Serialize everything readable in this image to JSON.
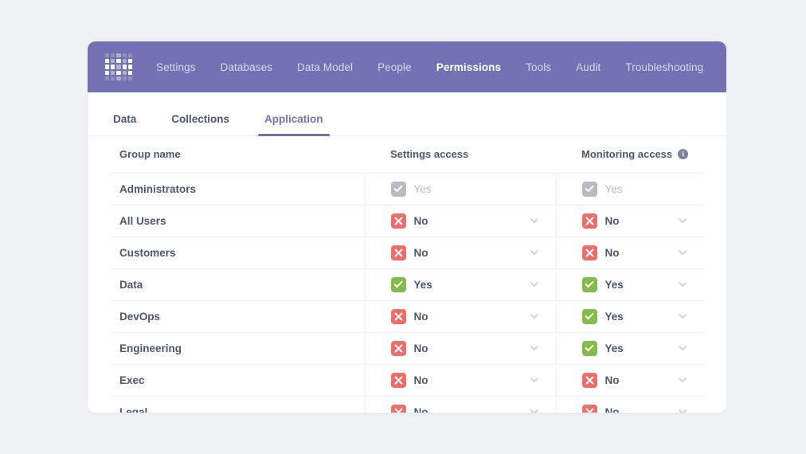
{
  "navbar": {
    "logo_name": "metabase-logo",
    "accent_color": "#7471b3",
    "links": [
      {
        "label": "Settings",
        "active": false
      },
      {
        "label": "Databases",
        "active": false
      },
      {
        "label": "Data Model",
        "active": false
      },
      {
        "label": "People",
        "active": false
      },
      {
        "label": "Permissions",
        "active": true
      },
      {
        "label": "Tools",
        "active": false
      },
      {
        "label": "Audit",
        "active": false
      },
      {
        "label": "Troubleshooting",
        "active": false
      }
    ]
  },
  "subtabs": [
    {
      "label": "Data",
      "active": false
    },
    {
      "label": "Collections",
      "active": false
    },
    {
      "label": "Application",
      "active": true
    }
  ],
  "table": {
    "columns": {
      "group": "Group name",
      "settings": "Settings access",
      "monitoring": "Monitoring access"
    },
    "monitoring_info_icon": "info-icon",
    "monitoring_info_glyph": "i",
    "rows": [
      {
        "group": "Administrators",
        "settings": {
          "value": "Yes",
          "state": "disabled",
          "has_dropdown": false
        },
        "monitoring": {
          "value": "Yes",
          "state": "disabled",
          "has_dropdown": false
        }
      },
      {
        "group": "All Users",
        "settings": {
          "value": "No",
          "state": "no",
          "has_dropdown": true
        },
        "monitoring": {
          "value": "No",
          "state": "no",
          "has_dropdown": true
        }
      },
      {
        "group": "Customers",
        "settings": {
          "value": "No",
          "state": "no",
          "has_dropdown": true
        },
        "monitoring": {
          "value": "No",
          "state": "no",
          "has_dropdown": true
        }
      },
      {
        "group": "Data",
        "settings": {
          "value": "Yes",
          "state": "yes",
          "has_dropdown": true
        },
        "monitoring": {
          "value": "Yes",
          "state": "yes",
          "has_dropdown": true
        }
      },
      {
        "group": "DevOps",
        "settings": {
          "value": "No",
          "state": "no",
          "has_dropdown": true
        },
        "monitoring": {
          "value": "Yes",
          "state": "yes",
          "has_dropdown": true
        }
      },
      {
        "group": "Engineering",
        "settings": {
          "value": "No",
          "state": "no",
          "has_dropdown": true
        },
        "monitoring": {
          "value": "Yes",
          "state": "yes",
          "has_dropdown": true
        }
      },
      {
        "group": "Exec",
        "settings": {
          "value": "No",
          "state": "no",
          "has_dropdown": true
        },
        "monitoring": {
          "value": "No",
          "state": "no",
          "has_dropdown": true
        }
      },
      {
        "group": "Legal",
        "settings": {
          "value": "No",
          "state": "no",
          "has_dropdown": true
        },
        "monitoring": {
          "value": "No",
          "state": "no",
          "has_dropdown": true
        }
      }
    ]
  },
  "colors": {
    "nav_purple": "#7471b3",
    "yes_green": "#84bb4c",
    "no_red": "#ed6e6e",
    "disabled_gray": "#b8bbc3",
    "text_dark": "#4c5773",
    "page_bg": "#f0f1f3"
  }
}
